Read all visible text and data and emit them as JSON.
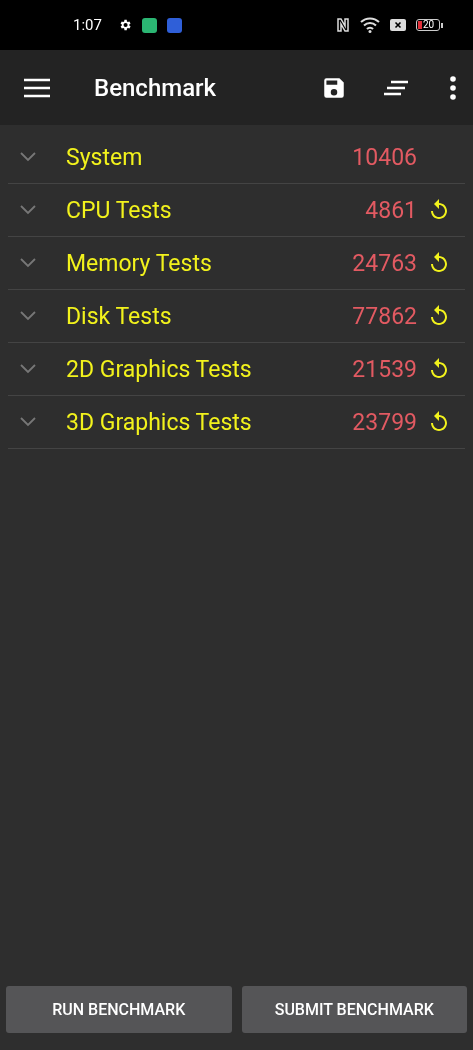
{
  "status_bar": {
    "time": "1:07",
    "battery": "20"
  },
  "toolbar": {
    "title": "Benchmark"
  },
  "results": [
    {
      "kind": "total",
      "name": "System",
      "score": "10406"
    },
    {
      "kind": "test",
      "name": "CPU Tests",
      "score": "4861"
    },
    {
      "kind": "test",
      "name": "Memory Tests",
      "score": "24763"
    },
    {
      "kind": "test",
      "name": "Disk Tests",
      "score": "77862"
    },
    {
      "kind": "test",
      "name": "2D Graphics Tests",
      "score": "21539"
    },
    {
      "kind": "test",
      "name": "3D Graphics Tests",
      "score": "23799"
    }
  ],
  "buttons": [
    "RUN BENCHMARK",
    "SUBMIT BENCHMARK"
  ]
}
